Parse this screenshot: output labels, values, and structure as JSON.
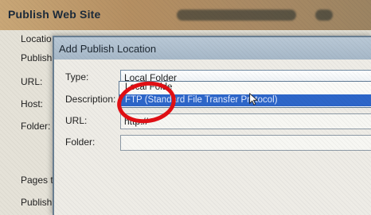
{
  "back_window": {
    "title": "Publish Web Site",
    "labels": [
      "Locatio",
      "Publish",
      "URL:",
      "Host:",
      "Folder:",
      "Pages t",
      "Publish"
    ]
  },
  "dialog": {
    "title": "Add Publish Location",
    "fields": {
      "type_label": "Type:",
      "type_value": "Local Folder",
      "description_label": "Description:",
      "url_label": "URL:",
      "url_value": "http://",
      "folder_label": "Folder:"
    },
    "dropdown": {
      "options": [
        "Local Folde",
        "FTP (Standard File Transfer Protocol)"
      ],
      "selected": "FTP (Standard File Transfer Protocol)"
    }
  },
  "annotation": {
    "color": "#e10f14",
    "shape": "red-circle"
  },
  "colors": {
    "dialog_title_bg": "#b9c8d6",
    "back_title_bg": "#c9a777",
    "selection_bg": "#2d66c9"
  },
  "icons": [
    "mouse-cursor-icon"
  ]
}
